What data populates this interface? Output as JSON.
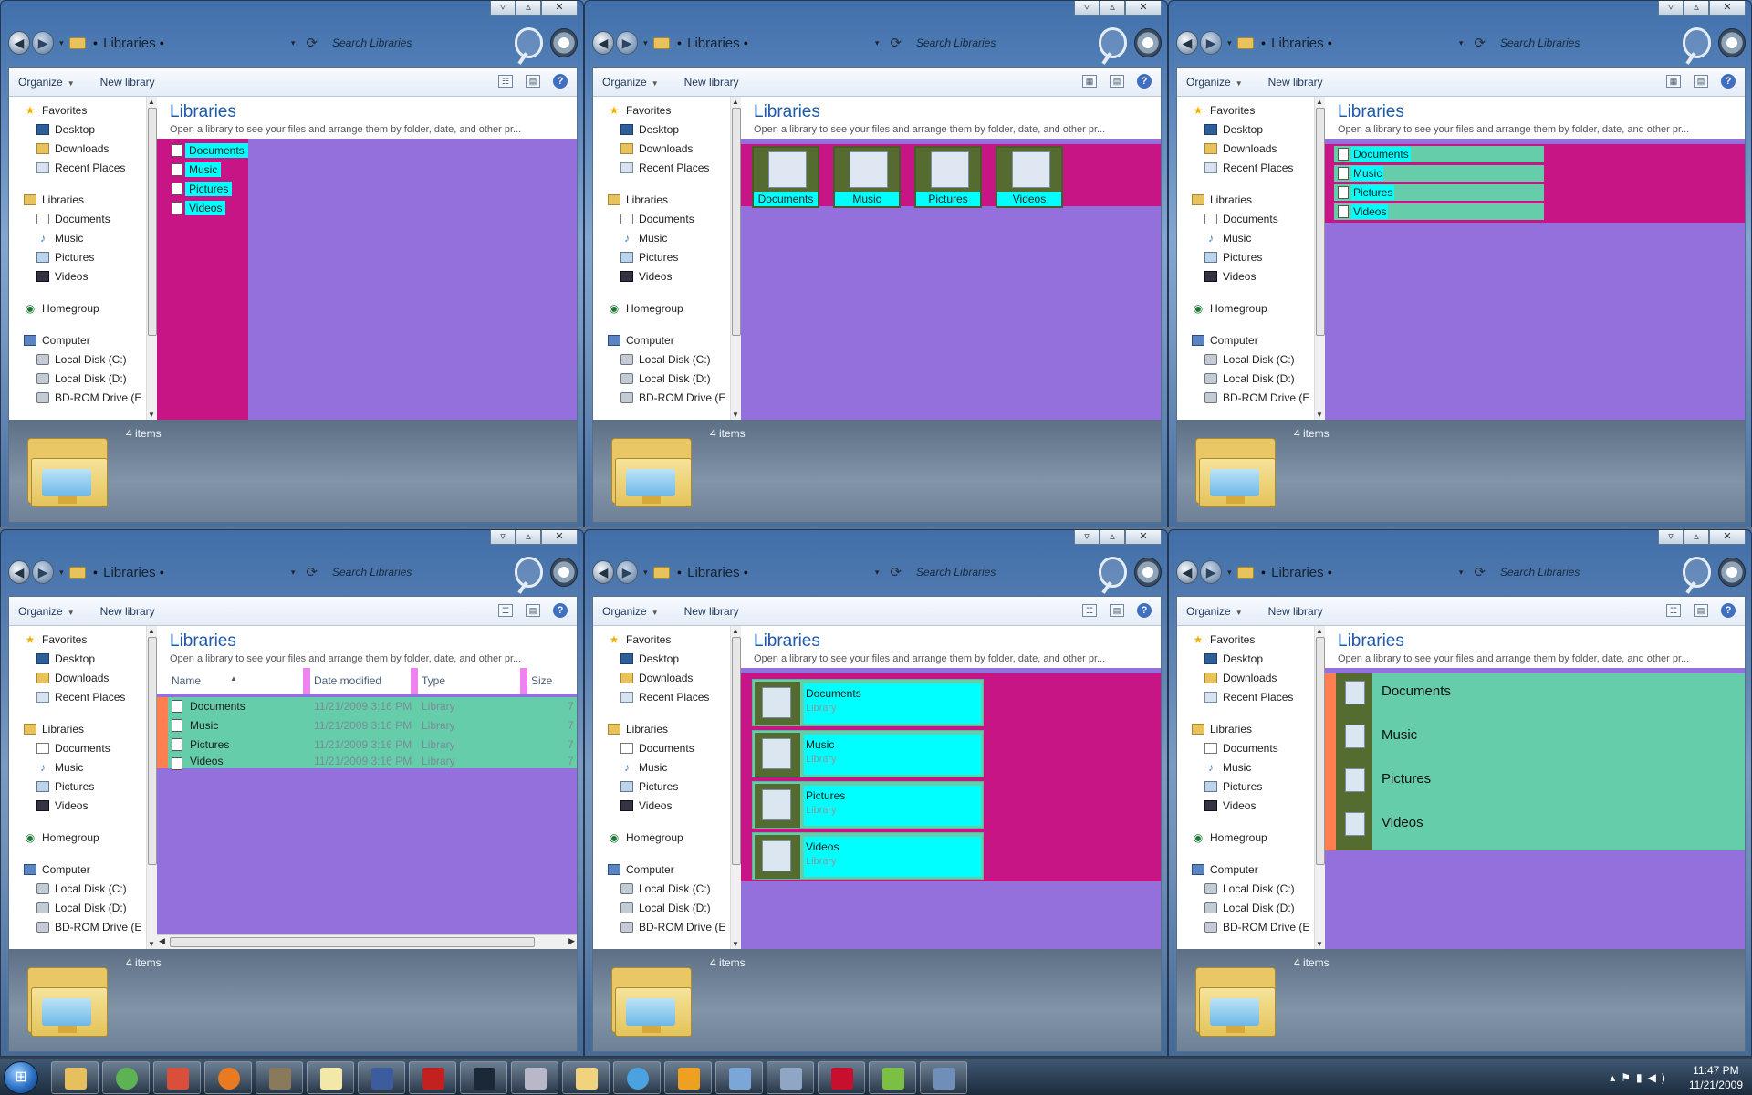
{
  "window": {
    "breadcrumb": "Libraries",
    "search_placeholder": "Search Libraries",
    "toolbar": {
      "organize": "Organize",
      "new_library": "New library"
    },
    "content_title": "Libraries",
    "content_subtitle": "Open a library to see your files and arrange them by folder, date, and other pr...",
    "details_count": "4 items",
    "nav": {
      "favorites": "Favorites",
      "desktop": "Desktop",
      "downloads": "Downloads",
      "recent": "Recent Places",
      "libraries": "Libraries",
      "documents": "Documents",
      "music": "Music",
      "pictures": "Pictures",
      "videos": "Videos",
      "homegroup": "Homegroup",
      "computer": "Computer",
      "disk_c": "Local Disk (C:)",
      "disk_d": "Local Disk (D:)",
      "bd": "BD-ROM Drive (E"
    },
    "libraries": [
      "Documents",
      "Music",
      "Pictures",
      "Videos"
    ],
    "library_kind": "Library",
    "columns": {
      "name": "Name",
      "date": "Date modified",
      "type": "Type",
      "size": "Size"
    },
    "date_value": "11/21/2009 3:16 PM",
    "size_value": "7"
  },
  "view_colors": {
    "background": "#9370db",
    "selection_band": "#c71585",
    "item_band": "#66cdaa",
    "label": "#00ffff",
    "icon_bg": "#556b2f",
    "edge": "#ff7f50",
    "column_separator": "#ee82ee"
  },
  "taskbar": {
    "time": "11:47 PM",
    "date": "11/21/2009"
  }
}
